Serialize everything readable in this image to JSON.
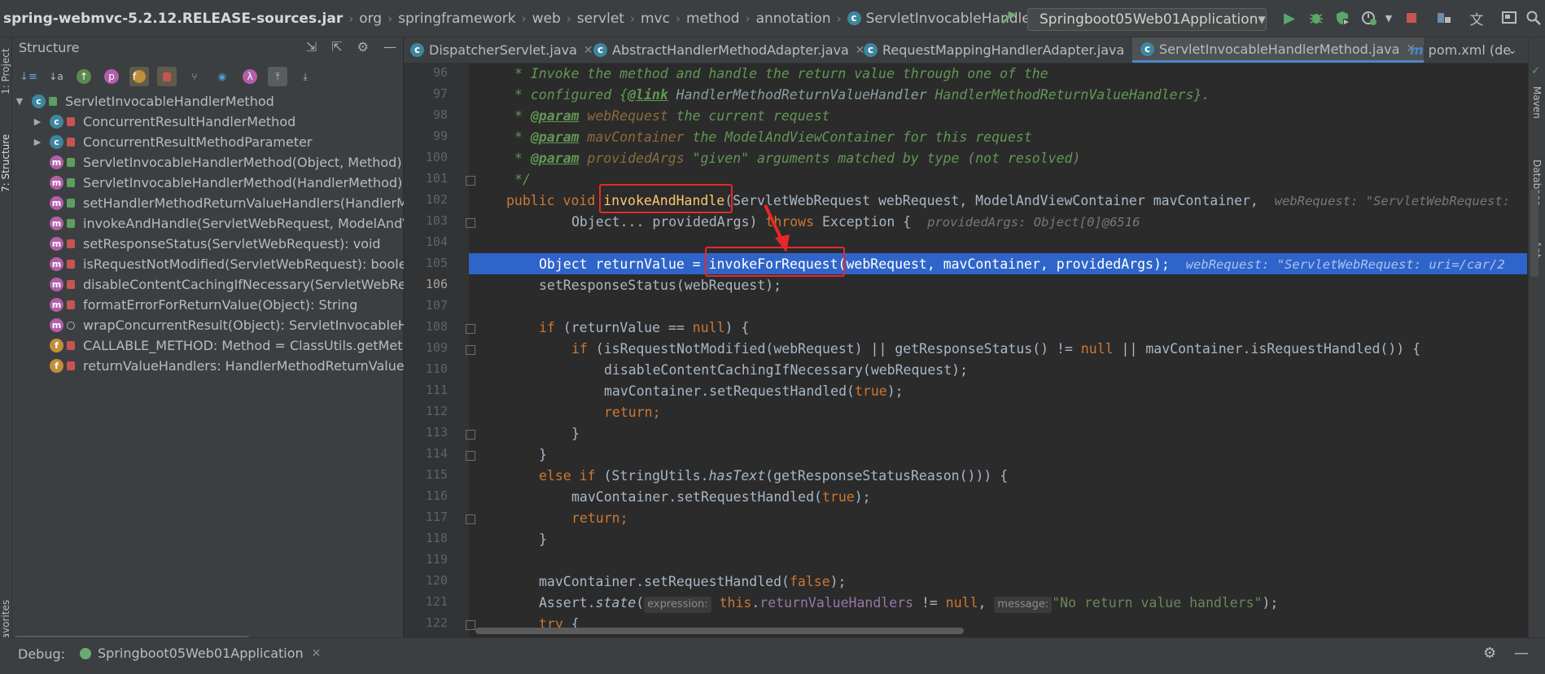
{
  "breadcrumb": {
    "items": [
      "spring-webmvc-5.2.12.RELEASE-sources.jar",
      "org",
      "springframework",
      "web",
      "servlet",
      "mvc",
      "method",
      "annotation",
      "ServletInvocableHandlerMethod"
    ]
  },
  "toolbar": {
    "run_config": "Springboot05Web01Application"
  },
  "side_tabs": {
    "project": "1: Project",
    "structure": "7: Structure",
    "favorites": "Favorites",
    "maven": "Maven",
    "database": "Database",
    "ant": "Ant"
  },
  "structure": {
    "title": "Structure",
    "root": "ServletInvocableHandlerMethod",
    "items": [
      {
        "label": "ConcurrentResultHandlerMethod",
        "icon": "class-icon",
        "expandable": true
      },
      {
        "label": "ConcurrentResultMethodParameter",
        "icon": "class-icon",
        "expandable": true
      },
      {
        "label": "ServletInvocableHandlerMethod(Object, Method)",
        "icon": "method-icon"
      },
      {
        "label": "ServletInvocableHandlerMethod(HandlerMethod)",
        "icon": "method-icon"
      },
      {
        "label": "setHandlerMethodReturnValueHandlers(HandlerMet",
        "icon": "method-icon"
      },
      {
        "label": "invokeAndHandle(ServletWebRequest, ModelAndVie",
        "icon": "method-icon"
      },
      {
        "label": "setResponseStatus(ServletWebRequest): void",
        "icon": "method-icon"
      },
      {
        "label": "isRequestNotModified(ServletWebRequest): boolean",
        "icon": "method-icon"
      },
      {
        "label": "disableContentCachingIfNecessary(ServletWebReque",
        "icon": "method-icon"
      },
      {
        "label": "formatErrorForReturnValue(Object): String",
        "icon": "method-icon"
      },
      {
        "label": "wrapConcurrentResult(Object): ServletInvocableHanc",
        "icon": "method-icon"
      },
      {
        "label": "CALLABLE_METHOD: Method = ClassUtils.getMethod",
        "icon": "field-icon"
      },
      {
        "label": "returnValueHandlers: HandlerMethodReturnValueHa",
        "icon": "field-icon"
      }
    ]
  },
  "tabs": [
    {
      "label": "DispatcherServlet.java"
    },
    {
      "label": "AbstractHandlerMethodAdapter.java"
    },
    {
      "label": "RequestMappingHandlerAdapter.java"
    },
    {
      "label": "ServletInvocableHandlerMethod.java",
      "active": true
    },
    {
      "label": "pom.xml (de"
    }
  ],
  "editor": {
    "line_numbers": [
      "96",
      "97",
      "98",
      "99",
      "100",
      "101",
      "102",
      "103",
      "104",
      "105",
      "106",
      "107",
      "108",
      "109",
      "110",
      "111",
      "112",
      "113",
      "114",
      "115",
      "116",
      "117",
      "118",
      "119",
      "120",
      "121",
      "122"
    ],
    "current_line": "106",
    "code": {
      "l96": "* Invoke the method and handle the return value through one of the",
      "l97_a": "* configured {",
      "l97_tag": "@link",
      "l97_b": " HandlerMethodReturnValueHandler ",
      "l97_c": "HandlerMethodReturnValueHandlers}.",
      "l98_tag": "@param",
      "l98_b": " webRequest ",
      "l98_c": "the current request",
      "l99_tag": "@param",
      "l99_b": " mavContainer ",
      "l99_c": "the ModelAndViewContainer for this request",
      "l100_tag": "@param",
      "l100_b": " providedArgs ",
      "l100_c": "\"given\" arguments matched by type (not resolved)",
      "l101": "*/",
      "l102_kw": "public void ",
      "l102_fn": "invokeAndHandle",
      "l102_rest": "(ServletWebRequest webRequest, ModelAndViewContainer mavContainer,",
      "l102_hint": "webRequest: \"ServletWebRequest:",
      "l103_a": "Object... providedArgs) ",
      "l103_kw": "throws",
      "l103_b": " Exception {",
      "l103_hint": "providedArgs: Object[0]@6516",
      "l105": "Object returnValue = invokeForRequest(webRequest, mavContainer, providedArgs);",
      "l105_hint": "webRequest: \"ServletWebRequest: uri=/car/2",
      "l106": "setResponseStatus(webRequest);",
      "l108_kw": "if",
      "l108_a": " (returnValue == ",
      "l108_null": "null",
      "l108_b": ") {",
      "l109_kw": "if",
      "l109_a": " (isRequestNotModified(webRequest) || getResponseStatus() != ",
      "l109_null": "null",
      "l109_b": " || mavContainer.isRequestHandled()) {",
      "l110": "disableContentCachingIfNecessary(webRequest);",
      "l111_a": "mavContainer.setRequestHandled(",
      "l111_kw": "true",
      "l111_b": ");",
      "l112": "return;",
      "l113": "}",
      "l114": "}",
      "l115_kw": "else if",
      "l115_a": " (StringUtils.",
      "l115_it": "hasText",
      "l115_b": "(getResponseStatusReason())) {",
      "l116_a": "mavContainer.setRequestHandled(",
      "l116_kw": "true",
      "l116_b": ");",
      "l117": "return;",
      "l118": "}",
      "l120_a": "mavContainer.setRequestHandled(",
      "l120_kw": "false",
      "l120_b": ");",
      "l121_a": "Assert.",
      "l121_it": "state",
      "l121_b": "(",
      "l121_pill1": "expression:",
      "l121_this": " this",
      "l121_c": ".",
      "l121_fld": "returnValueHandlers",
      "l121_d": " != ",
      "l121_null": "null",
      "l121_e": ", ",
      "l121_pill2": "message:",
      "l121_str": "\"No return value handlers\"",
      "l121_f": ");",
      "l122_kw": "try",
      "l122_b": " {"
    }
  },
  "debug": {
    "label": "Debug:",
    "session": "Springboot05Web01Application"
  },
  "colors": {
    "accent": "#4a88c7",
    "selection": "#2f65ca",
    "annotation_box": "#e8272a"
  }
}
